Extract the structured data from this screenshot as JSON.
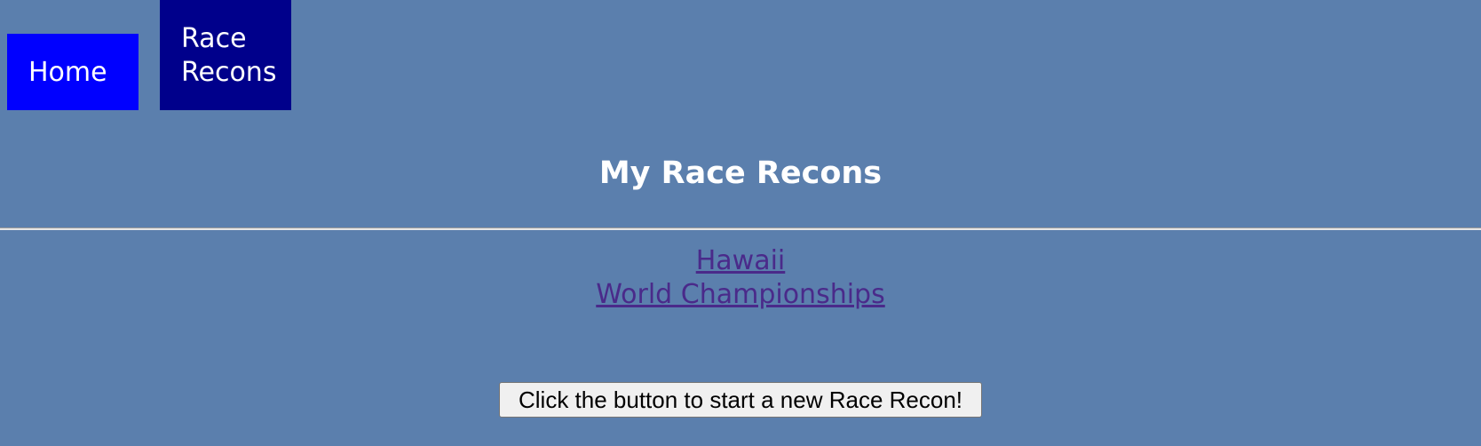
{
  "nav": {
    "home_label": "Home",
    "race_recons_label_line1": "Race",
    "race_recons_label_line2": "Recons"
  },
  "page": {
    "title": "My Race Recons"
  },
  "recons": {
    "items": [
      {
        "line1": "Hawaii",
        "line2": "World Championships"
      }
    ]
  },
  "actions": {
    "new_recon_button": "Click the button to start a new Race Recon!"
  },
  "colors": {
    "background": "#5b7fad",
    "nav_home_bg": "#0000ff",
    "nav_active_bg": "#00008b",
    "link": "#4a2a8a"
  }
}
